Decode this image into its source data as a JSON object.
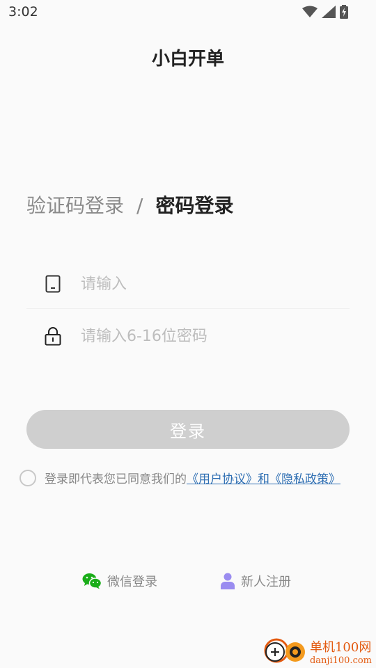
{
  "status": {
    "time": "3:02"
  },
  "app": {
    "title": "小白开单"
  },
  "tabs": {
    "sms": "验证码登录",
    "separator": "/",
    "password": "密码登录",
    "active": "password"
  },
  "form": {
    "phone_placeholder": "请输入",
    "password_placeholder": "请输入6-16位密码",
    "login_label": "登录"
  },
  "agreement": {
    "prefix": "登录即代表您已同意我们的",
    "user_agreement": "《用户协议》",
    "conj": "和",
    "privacy_policy": "《隐私政策》",
    "checked": false
  },
  "bottom": {
    "wechat_label": "微信登录",
    "register_label": "新人注册"
  },
  "watermark": {
    "main": "单机100网",
    "sub": "danji100.com"
  },
  "colors": {
    "wechat": "#1aad19",
    "register": "#9a8cf0",
    "link": "#2f6fb3",
    "button_disabled": "#cfcfcf",
    "watermark": "#e35a10"
  },
  "icons": {
    "phone": "phone-icon",
    "lock": "lock-icon",
    "wechat": "wechat-icon",
    "person": "person-icon",
    "wifi": "wifi-icon",
    "signal": "signal-icon",
    "battery": "battery-charging-icon"
  }
}
